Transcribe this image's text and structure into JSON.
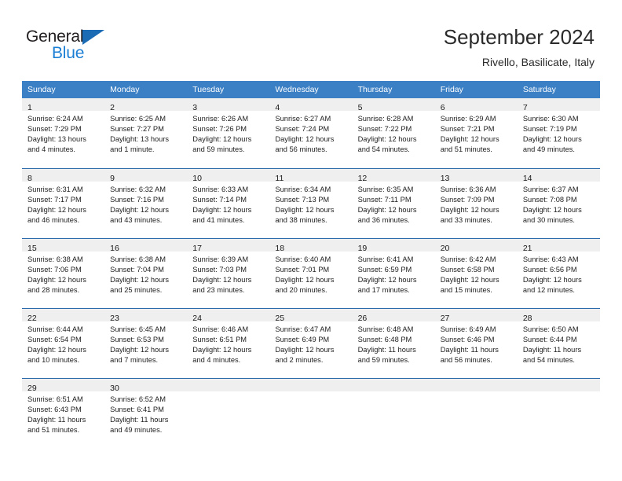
{
  "brand": {
    "name_top": "General",
    "name_bottom": "Blue",
    "triangle_color": "#1b6cb5",
    "bottom_color": "#1b7fd4"
  },
  "header": {
    "title": "September 2024",
    "subtitle": "Rivello, Basilicate, Italy"
  },
  "theme": {
    "header_blue": "#3b7fc4",
    "rule_blue": "#2c6aab",
    "date_band_gray": "#efefef",
    "text": "#222222"
  },
  "columns": [
    "Sunday",
    "Monday",
    "Tuesday",
    "Wednesday",
    "Thursday",
    "Friday",
    "Saturday"
  ],
  "weeks": [
    [
      {
        "day": "1",
        "l1": "Sunrise: 6:24 AM",
        "l2": "Sunset: 7:29 PM",
        "l3": "Daylight: 13 hours",
        "l4": "and 4 minutes."
      },
      {
        "day": "2",
        "l1": "Sunrise: 6:25 AM",
        "l2": "Sunset: 7:27 PM",
        "l3": "Daylight: 13 hours",
        "l4": "and 1 minute."
      },
      {
        "day": "3",
        "l1": "Sunrise: 6:26 AM",
        "l2": "Sunset: 7:26 PM",
        "l3": "Daylight: 12 hours",
        "l4": "and 59 minutes."
      },
      {
        "day": "4",
        "l1": "Sunrise: 6:27 AM",
        "l2": "Sunset: 7:24 PM",
        "l3": "Daylight: 12 hours",
        "l4": "and 56 minutes."
      },
      {
        "day": "5",
        "l1": "Sunrise: 6:28 AM",
        "l2": "Sunset: 7:22 PM",
        "l3": "Daylight: 12 hours",
        "l4": "and 54 minutes."
      },
      {
        "day": "6",
        "l1": "Sunrise: 6:29 AM",
        "l2": "Sunset: 7:21 PM",
        "l3": "Daylight: 12 hours",
        "l4": "and 51 minutes."
      },
      {
        "day": "7",
        "l1": "Sunrise: 6:30 AM",
        "l2": "Sunset: 7:19 PM",
        "l3": "Daylight: 12 hours",
        "l4": "and 49 minutes."
      }
    ],
    [
      {
        "day": "8",
        "l1": "Sunrise: 6:31 AM",
        "l2": "Sunset: 7:17 PM",
        "l3": "Daylight: 12 hours",
        "l4": "and 46 minutes."
      },
      {
        "day": "9",
        "l1": "Sunrise: 6:32 AM",
        "l2": "Sunset: 7:16 PM",
        "l3": "Daylight: 12 hours",
        "l4": "and 43 minutes."
      },
      {
        "day": "10",
        "l1": "Sunrise: 6:33 AM",
        "l2": "Sunset: 7:14 PM",
        "l3": "Daylight: 12 hours",
        "l4": "and 41 minutes."
      },
      {
        "day": "11",
        "l1": "Sunrise: 6:34 AM",
        "l2": "Sunset: 7:13 PM",
        "l3": "Daylight: 12 hours",
        "l4": "and 38 minutes."
      },
      {
        "day": "12",
        "l1": "Sunrise: 6:35 AM",
        "l2": "Sunset: 7:11 PM",
        "l3": "Daylight: 12 hours",
        "l4": "and 36 minutes."
      },
      {
        "day": "13",
        "l1": "Sunrise: 6:36 AM",
        "l2": "Sunset: 7:09 PM",
        "l3": "Daylight: 12 hours",
        "l4": "and 33 minutes."
      },
      {
        "day": "14",
        "l1": "Sunrise: 6:37 AM",
        "l2": "Sunset: 7:08 PM",
        "l3": "Daylight: 12 hours",
        "l4": "and 30 minutes."
      }
    ],
    [
      {
        "day": "15",
        "l1": "Sunrise: 6:38 AM",
        "l2": "Sunset: 7:06 PM",
        "l3": "Daylight: 12 hours",
        "l4": "and 28 minutes."
      },
      {
        "day": "16",
        "l1": "Sunrise: 6:38 AM",
        "l2": "Sunset: 7:04 PM",
        "l3": "Daylight: 12 hours",
        "l4": "and 25 minutes."
      },
      {
        "day": "17",
        "l1": "Sunrise: 6:39 AM",
        "l2": "Sunset: 7:03 PM",
        "l3": "Daylight: 12 hours",
        "l4": "and 23 minutes."
      },
      {
        "day": "18",
        "l1": "Sunrise: 6:40 AM",
        "l2": "Sunset: 7:01 PM",
        "l3": "Daylight: 12 hours",
        "l4": "and 20 minutes."
      },
      {
        "day": "19",
        "l1": "Sunrise: 6:41 AM",
        "l2": "Sunset: 6:59 PM",
        "l3": "Daylight: 12 hours",
        "l4": "and 17 minutes."
      },
      {
        "day": "20",
        "l1": "Sunrise: 6:42 AM",
        "l2": "Sunset: 6:58 PM",
        "l3": "Daylight: 12 hours",
        "l4": "and 15 minutes."
      },
      {
        "day": "21",
        "l1": "Sunrise: 6:43 AM",
        "l2": "Sunset: 6:56 PM",
        "l3": "Daylight: 12 hours",
        "l4": "and 12 minutes."
      }
    ],
    [
      {
        "day": "22",
        "l1": "Sunrise: 6:44 AM",
        "l2": "Sunset: 6:54 PM",
        "l3": "Daylight: 12 hours",
        "l4": "and 10 minutes."
      },
      {
        "day": "23",
        "l1": "Sunrise: 6:45 AM",
        "l2": "Sunset: 6:53 PM",
        "l3": "Daylight: 12 hours",
        "l4": "and 7 minutes."
      },
      {
        "day": "24",
        "l1": "Sunrise: 6:46 AM",
        "l2": "Sunset: 6:51 PM",
        "l3": "Daylight: 12 hours",
        "l4": "and 4 minutes."
      },
      {
        "day": "25",
        "l1": "Sunrise: 6:47 AM",
        "l2": "Sunset: 6:49 PM",
        "l3": "Daylight: 12 hours",
        "l4": "and 2 minutes."
      },
      {
        "day": "26",
        "l1": "Sunrise: 6:48 AM",
        "l2": "Sunset: 6:48 PM",
        "l3": "Daylight: 11 hours",
        "l4": "and 59 minutes."
      },
      {
        "day": "27",
        "l1": "Sunrise: 6:49 AM",
        "l2": "Sunset: 6:46 PM",
        "l3": "Daylight: 11 hours",
        "l4": "and 56 minutes."
      },
      {
        "day": "28",
        "l1": "Sunrise: 6:50 AM",
        "l2": "Sunset: 6:44 PM",
        "l3": "Daylight: 11 hours",
        "l4": "and 54 minutes."
      }
    ],
    [
      {
        "day": "29",
        "l1": "Sunrise: 6:51 AM",
        "l2": "Sunset: 6:43 PM",
        "l3": "Daylight: 11 hours",
        "l4": "and 51 minutes."
      },
      {
        "day": "30",
        "l1": "Sunrise: 6:52 AM",
        "l2": "Sunset: 6:41 PM",
        "l3": "Daylight: 11 hours",
        "l4": "and 49 minutes."
      },
      {
        "day": "",
        "l1": "",
        "l2": "",
        "l3": "",
        "l4": ""
      },
      {
        "day": "",
        "l1": "",
        "l2": "",
        "l3": "",
        "l4": ""
      },
      {
        "day": "",
        "l1": "",
        "l2": "",
        "l3": "",
        "l4": ""
      },
      {
        "day": "",
        "l1": "",
        "l2": "",
        "l3": "",
        "l4": ""
      },
      {
        "day": "",
        "l1": "",
        "l2": "",
        "l3": "",
        "l4": ""
      }
    ]
  ]
}
